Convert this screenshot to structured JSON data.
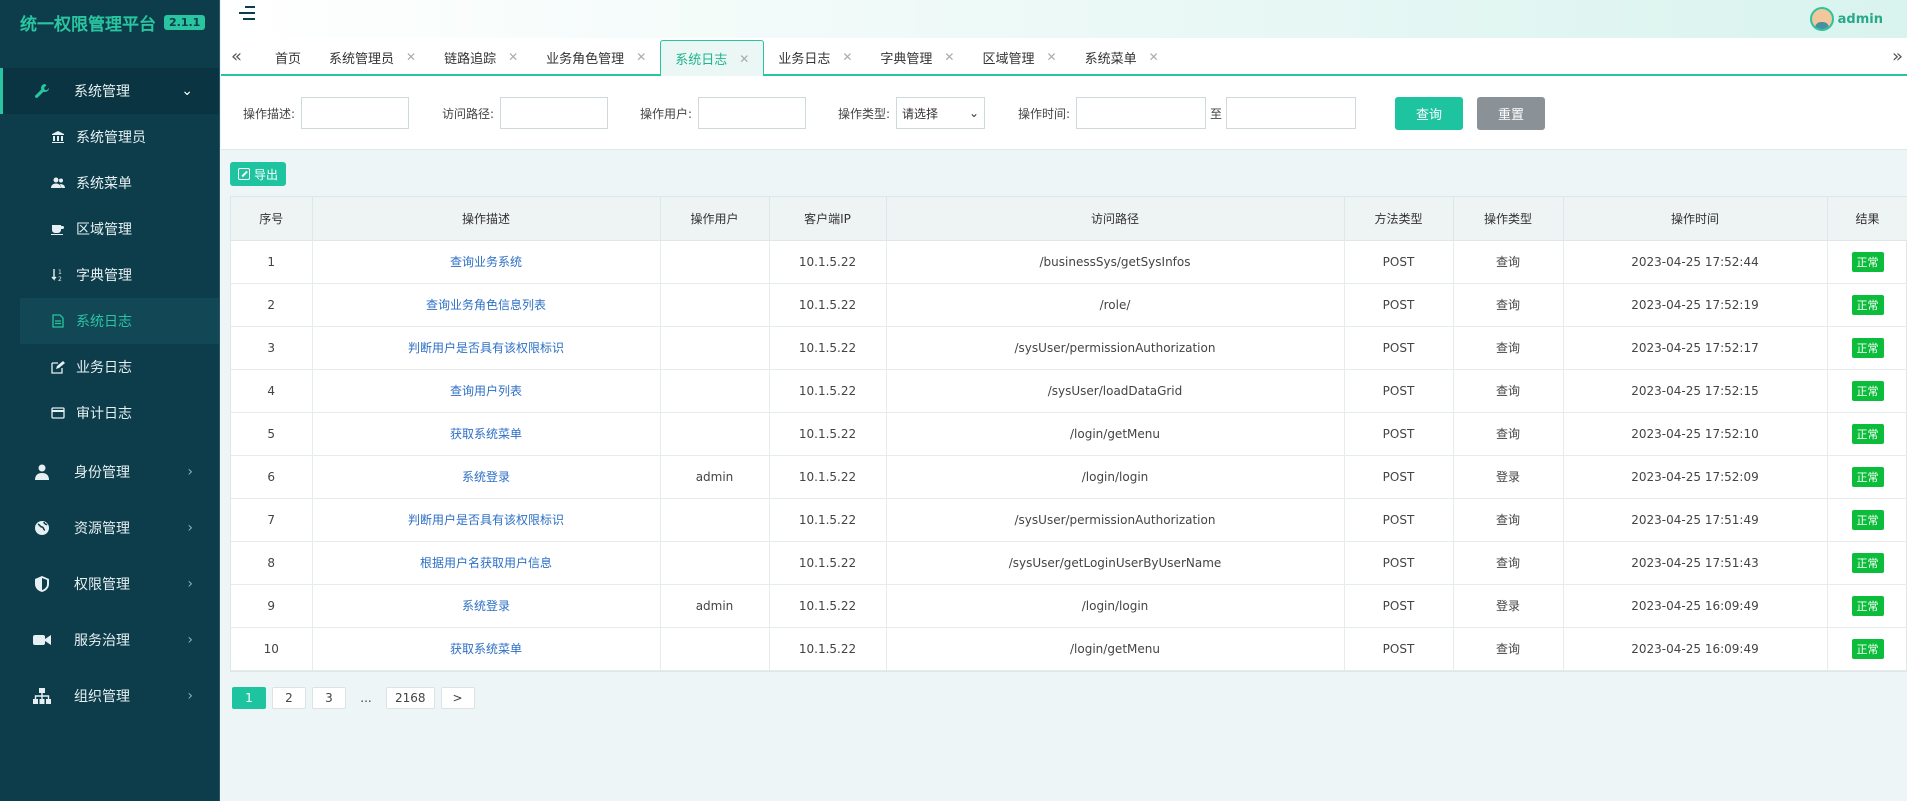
{
  "app": {
    "title": "统一权限管理平台",
    "version": "2.1.1"
  },
  "user": {
    "name": "admin"
  },
  "sidebar": {
    "system_group": {
      "label": "系统管理",
      "icon": "wrench-icon"
    },
    "sub_items": [
      {
        "label": "系统管理员",
        "icon": "bank-icon"
      },
      {
        "label": "系统菜单",
        "icon": "users-icon"
      },
      {
        "label": "区域管理",
        "icon": "cup-icon"
      },
      {
        "label": "字典管理",
        "icon": "sort-icon"
      },
      {
        "label": "系统日志",
        "icon": "file-icon"
      },
      {
        "label": "业务日志",
        "icon": "edit-icon"
      },
      {
        "label": "审计日志",
        "icon": "card-icon"
      }
    ],
    "groups": [
      {
        "label": "身份管理",
        "icon": "user-icon"
      },
      {
        "label": "资源管理",
        "icon": "globe-icon"
      },
      {
        "label": "权限管理",
        "icon": "shield-icon"
      },
      {
        "label": "服务治理",
        "icon": "video-icon"
      },
      {
        "label": "组织管理",
        "icon": "sitemap-icon"
      }
    ]
  },
  "tabs": [
    {
      "label": "首页"
    },
    {
      "label": "系统管理员"
    },
    {
      "label": "链路追踪"
    },
    {
      "label": "业务角色管理"
    },
    {
      "label": "系统日志"
    },
    {
      "label": "业务日志"
    },
    {
      "label": "字典管理"
    },
    {
      "label": "区域管理"
    },
    {
      "label": "系统菜单"
    }
  ],
  "search": {
    "desc_label": "操作描述:",
    "path_label": "访问路径:",
    "user_label": "操作用户:",
    "type_label": "操作类型:",
    "type_value": "请选择",
    "time_label": "操作时间:",
    "to_label": "至",
    "query_button": "查询",
    "reset_button": "重置"
  },
  "export_button": "导出",
  "table": {
    "headers": [
      "序号",
      "操作描述",
      "操作用户",
      "客户端IP",
      "访问路径",
      "方法类型",
      "操作类型",
      "操作时间",
      "结果"
    ],
    "rows": [
      [
        "1",
        "查询业务系统",
        "",
        "10.1.5.22",
        "/businessSys/getSysInfos",
        "POST",
        "查询",
        "2023-04-25 17:52:44",
        "正常"
      ],
      [
        "2",
        "查询业务角色信息列表",
        "",
        "10.1.5.22",
        "/role/",
        "POST",
        "查询",
        "2023-04-25 17:52:19",
        "正常"
      ],
      [
        "3",
        "判断用户是否具有该权限标识",
        "",
        "10.1.5.22",
        "/sysUser/permissionAuthorization",
        "POST",
        "查询",
        "2023-04-25 17:52:17",
        "正常"
      ],
      [
        "4",
        "查询用户列表",
        "",
        "10.1.5.22",
        "/sysUser/loadDataGrid",
        "POST",
        "查询",
        "2023-04-25 17:52:15",
        "正常"
      ],
      [
        "5",
        "获取系统菜单",
        "",
        "10.1.5.22",
        "/login/getMenu",
        "POST",
        "查询",
        "2023-04-25 17:52:10",
        "正常"
      ],
      [
        "6",
        "系统登录",
        "admin",
        "10.1.5.22",
        "/login/login",
        "POST",
        "登录",
        "2023-04-25 17:52:09",
        "正常"
      ],
      [
        "7",
        "判断用户是否具有该权限标识",
        "",
        "10.1.5.22",
        "/sysUser/permissionAuthorization",
        "POST",
        "查询",
        "2023-04-25 17:51:49",
        "正常"
      ],
      [
        "8",
        "根据用户名获取用户信息",
        "",
        "10.1.5.22",
        "/sysUser/getLoginUserByUserName",
        "POST",
        "查询",
        "2023-04-25 17:51:43",
        "正常"
      ],
      [
        "9",
        "系统登录",
        "admin",
        "10.1.5.22",
        "/login/login",
        "POST",
        "登录",
        "2023-04-25 16:09:49",
        "正常"
      ],
      [
        "10",
        "获取系统菜单",
        "",
        "10.1.5.22",
        "/login/getMenu",
        "POST",
        "查询",
        "2023-04-25 16:09:49",
        "正常"
      ]
    ]
  },
  "pager": {
    "pages": [
      "1",
      "2",
      "3",
      "...",
      "2168",
      ">"
    ],
    "current": "1"
  },
  "colors": {
    "accent": "#1ec49f",
    "sidebar": "#0d3c4a",
    "status_ok": "#0bbd3a",
    "link": "#2d6fc4"
  }
}
